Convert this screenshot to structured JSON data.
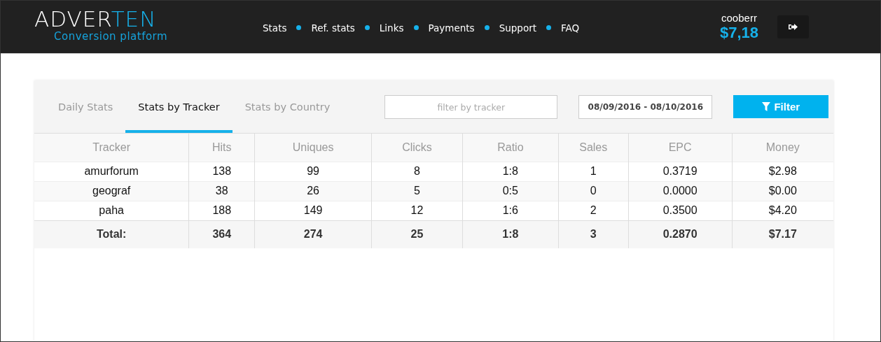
{
  "logo": {
    "main": "ADVER",
    "accent": "TEN",
    "tagline": "Conversion platform"
  },
  "nav": [
    "Stats",
    "Ref. stats",
    "Links",
    "Payments",
    "Support",
    "FAQ"
  ],
  "user": {
    "name": "cooberr",
    "balance": "$7,18"
  },
  "tabs": [
    {
      "label": "Daily Stats",
      "selected": false
    },
    {
      "label": "Stats by Tracker",
      "selected": true
    },
    {
      "label": "Stats by Country",
      "selected": false
    }
  ],
  "search": {
    "placeholder": "filter by tracker"
  },
  "date_range": "08/09/2016 - 08/10/2016",
  "filter_button": "Filter",
  "table": {
    "columns": [
      "Tracker",
      "Hits",
      "Uniques",
      "Clicks",
      "Ratio",
      "Sales",
      "EPC",
      "Money"
    ],
    "rows": [
      [
        "amurforum",
        "138",
        "99",
        "8",
        "1:8",
        "1",
        "0.3719",
        "$2.98"
      ],
      [
        "geograf",
        "38",
        "26",
        "5",
        "0:5",
        "0",
        "0.0000",
        "$0.00"
      ],
      [
        "paha",
        "188",
        "149",
        "12",
        "1:6",
        "2",
        "0.3500",
        "$4.20"
      ]
    ],
    "total": [
      "Total:",
      "364",
      "274",
      "25",
      "1:8",
      "3",
      "0.2870",
      "$7.17"
    ]
  }
}
